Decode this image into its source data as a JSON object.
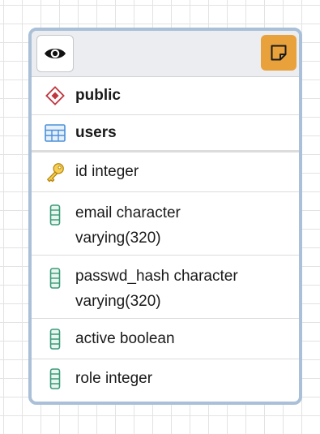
{
  "node": {
    "schema_label": "public",
    "table_label": "users",
    "columns": [
      {
        "label": "id integer",
        "icon": "primary-key-icon",
        "key": true
      },
      {
        "label_line1": "email character",
        "label_line2": "varying(320)",
        "icon": "column-icon"
      },
      {
        "label_line1": "passwd_hash character",
        "label_line2": "varying(320)",
        "icon": "column-icon"
      },
      {
        "label": "active boolean",
        "icon": "column-icon"
      },
      {
        "label": "role integer",
        "icon": "column-icon"
      }
    ]
  },
  "header": {
    "eye_icon": "eye-icon",
    "note_icon": "note-icon"
  },
  "colors": {
    "accent": "#e9a23b",
    "border": "#a9c0d8",
    "schema_icon": "#c0353f",
    "table_icon": "#4a90d9",
    "column_icon": "#3a9a78",
    "key_icon": "#e2b23b"
  }
}
